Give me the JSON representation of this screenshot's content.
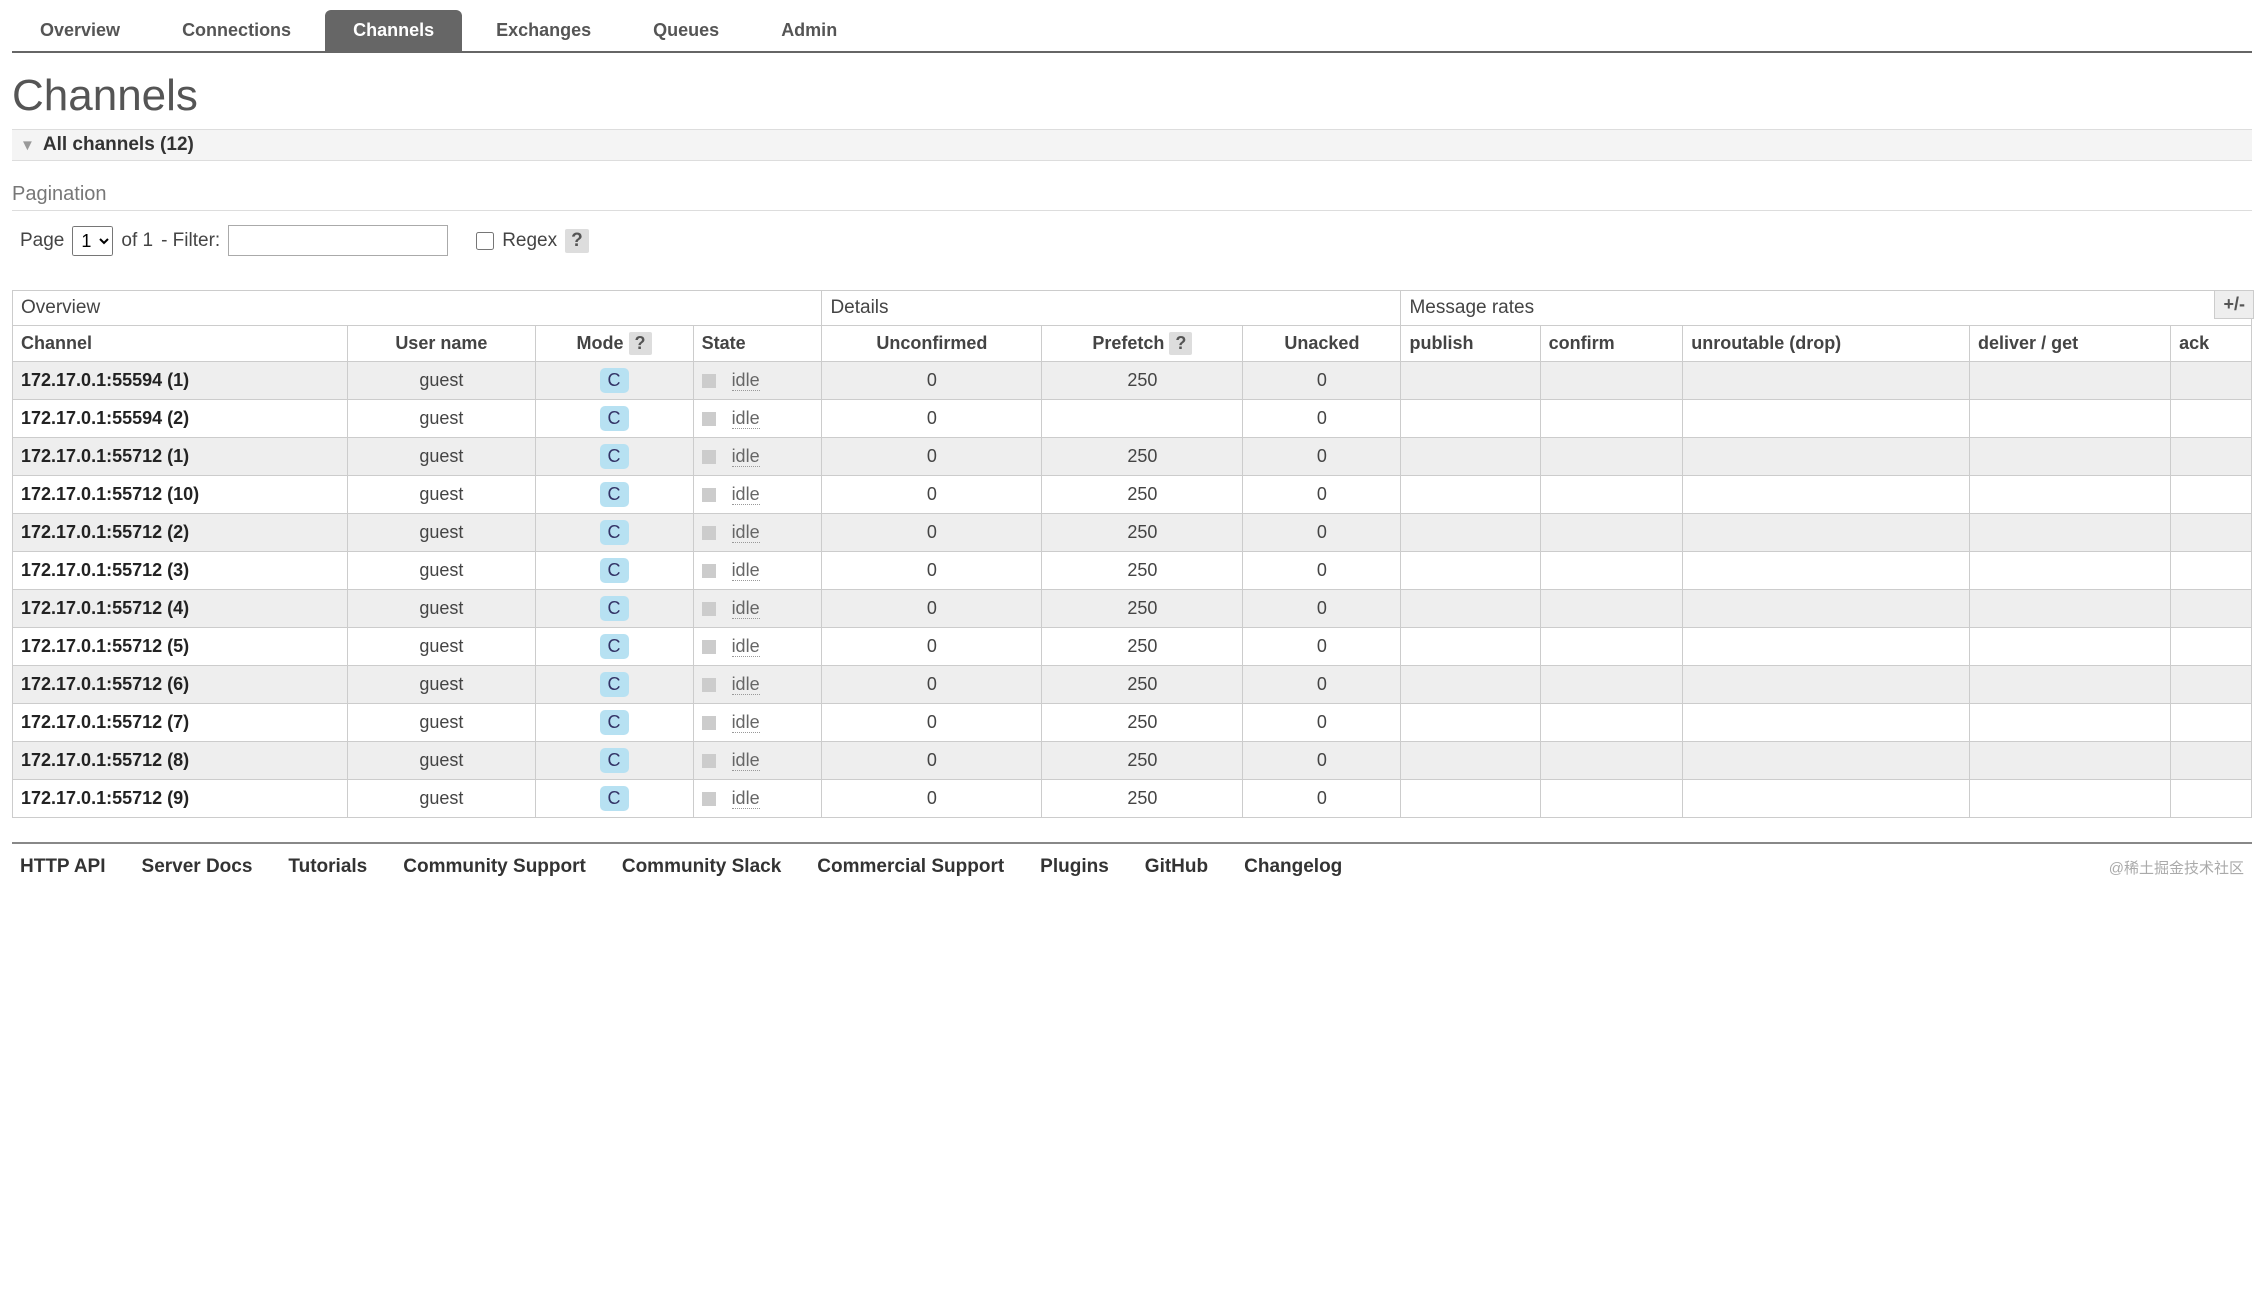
{
  "tabs": [
    "Overview",
    "Connections",
    "Channels",
    "Exchanges",
    "Queues",
    "Admin"
  ],
  "active_tab": "Channels",
  "page_title": "Channels",
  "section_title": "All channels (12)",
  "pagination": {
    "title": "Pagination",
    "page_label": "Page",
    "page_value": "1",
    "of_label": "of 1",
    "filter_label": "- Filter:",
    "regex_label": "Regex",
    "help": "?"
  },
  "groups": {
    "overview": "Overview",
    "details": "Details",
    "rates": "Message rates"
  },
  "plusminus": "+/-",
  "columns": {
    "channel": "Channel",
    "user": "User name",
    "mode": "Mode",
    "mode_help": "?",
    "state": "State",
    "unconfirmed": "Unconfirmed",
    "prefetch": "Prefetch",
    "prefetch_help": "?",
    "unacked": "Unacked",
    "publish": "publish",
    "confirm": "confirm",
    "unroutable": "unroutable (drop)",
    "deliver": "deliver / get",
    "ack": "ack"
  },
  "rows": [
    {
      "channel": "172.17.0.1:55594 (1)",
      "user": "guest",
      "mode": "C",
      "state": "idle",
      "unconfirmed": "0",
      "prefetch": "250",
      "unacked": "0"
    },
    {
      "channel": "172.17.0.1:55594 (2)",
      "user": "guest",
      "mode": "C",
      "state": "idle",
      "unconfirmed": "0",
      "prefetch": "",
      "unacked": "0"
    },
    {
      "channel": "172.17.0.1:55712 (1)",
      "user": "guest",
      "mode": "C",
      "state": "idle",
      "unconfirmed": "0",
      "prefetch": "250",
      "unacked": "0"
    },
    {
      "channel": "172.17.0.1:55712 (10)",
      "user": "guest",
      "mode": "C",
      "state": "idle",
      "unconfirmed": "0",
      "prefetch": "250",
      "unacked": "0"
    },
    {
      "channel": "172.17.0.1:55712 (2)",
      "user": "guest",
      "mode": "C",
      "state": "idle",
      "unconfirmed": "0",
      "prefetch": "250",
      "unacked": "0"
    },
    {
      "channel": "172.17.0.1:55712 (3)",
      "user": "guest",
      "mode": "C",
      "state": "idle",
      "unconfirmed": "0",
      "prefetch": "250",
      "unacked": "0"
    },
    {
      "channel": "172.17.0.1:55712 (4)",
      "user": "guest",
      "mode": "C",
      "state": "idle",
      "unconfirmed": "0",
      "prefetch": "250",
      "unacked": "0"
    },
    {
      "channel": "172.17.0.1:55712 (5)",
      "user": "guest",
      "mode": "C",
      "state": "idle",
      "unconfirmed": "0",
      "prefetch": "250",
      "unacked": "0"
    },
    {
      "channel": "172.17.0.1:55712 (6)",
      "user": "guest",
      "mode": "C",
      "state": "idle",
      "unconfirmed": "0",
      "prefetch": "250",
      "unacked": "0"
    },
    {
      "channel": "172.17.0.1:55712 (7)",
      "user": "guest",
      "mode": "C",
      "state": "idle",
      "unconfirmed": "0",
      "prefetch": "250",
      "unacked": "0"
    },
    {
      "channel": "172.17.0.1:55712 (8)",
      "user": "guest",
      "mode": "C",
      "state": "idle",
      "unconfirmed": "0",
      "prefetch": "250",
      "unacked": "0"
    },
    {
      "channel": "172.17.0.1:55712 (9)",
      "user": "guest",
      "mode": "C",
      "state": "idle",
      "unconfirmed": "0",
      "prefetch": "250",
      "unacked": "0"
    }
  ],
  "footer_links": [
    "HTTP API",
    "Server Docs",
    "Tutorials",
    "Community Support",
    "Community Slack",
    "Commercial Support",
    "Plugins",
    "GitHub",
    "Changelog"
  ],
  "watermark": "@稀土掘金技术社区"
}
